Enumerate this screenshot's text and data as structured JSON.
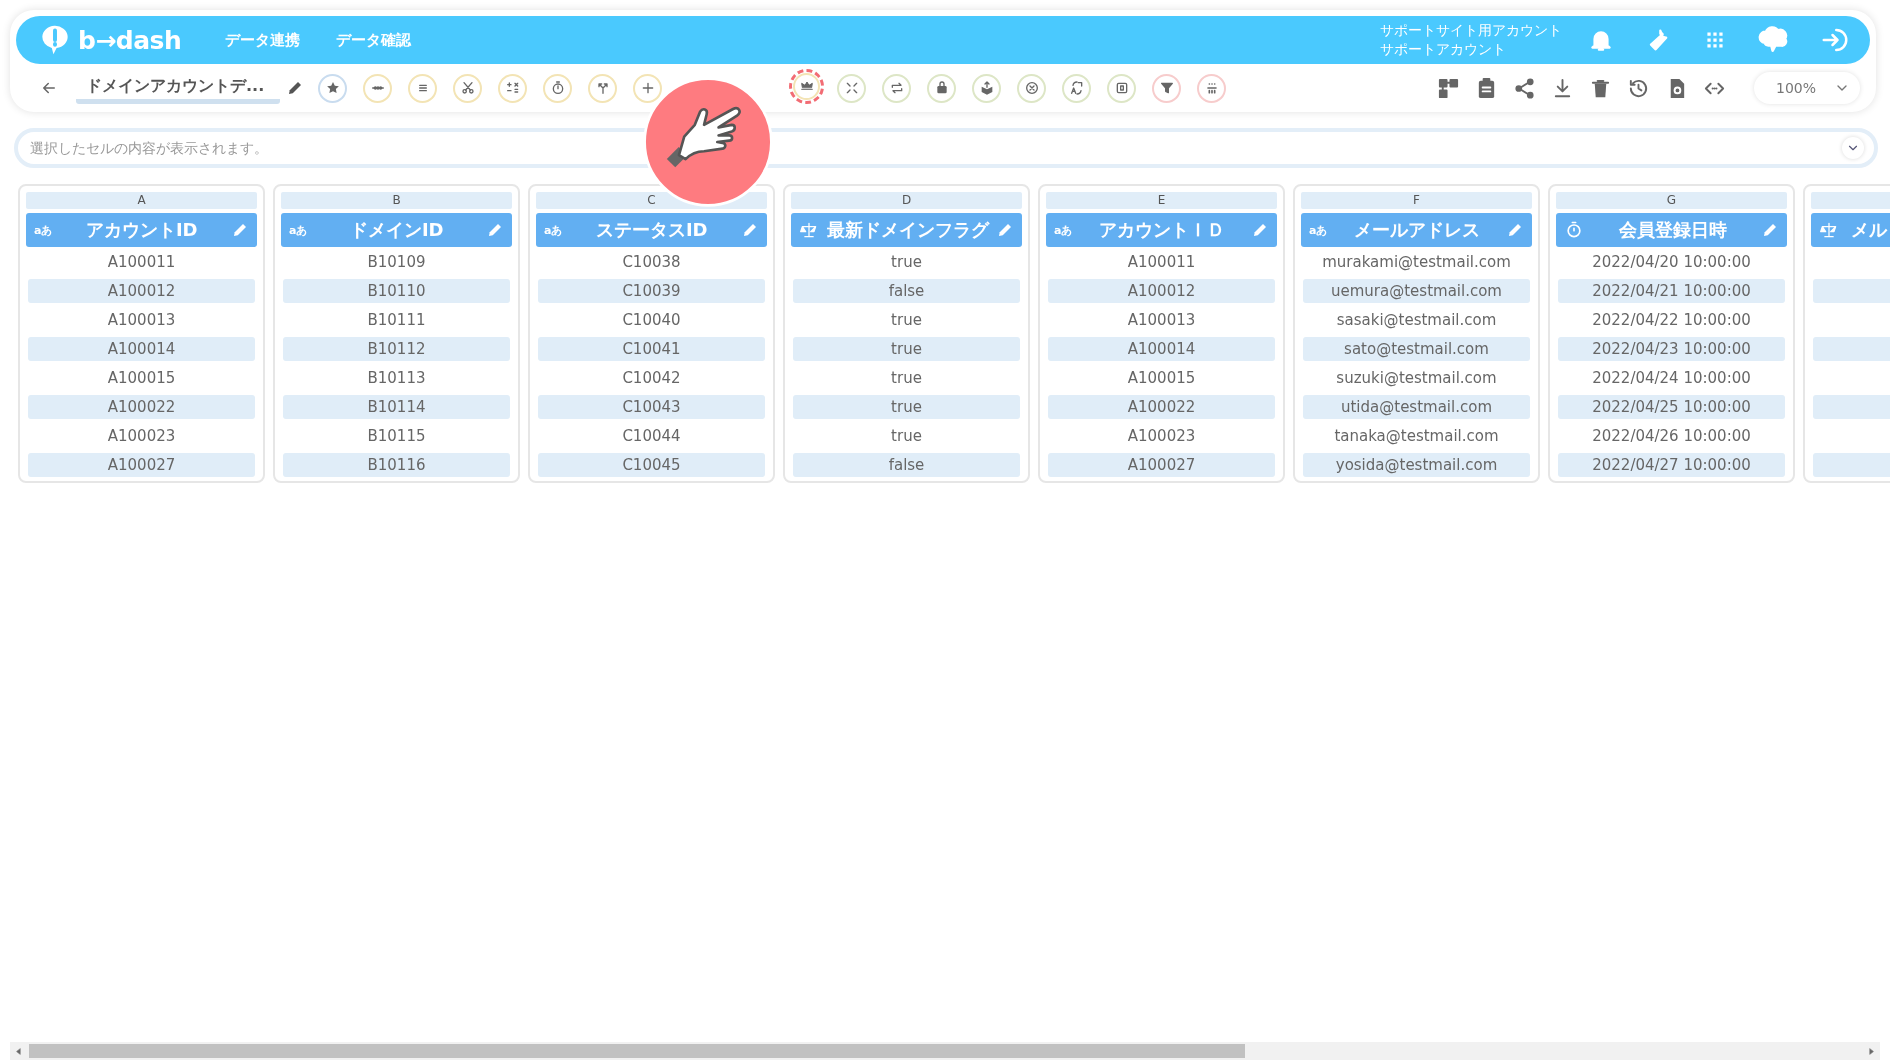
{
  "header": {
    "logo": "b→dash",
    "nav": [
      "データ連携",
      "データ確認"
    ],
    "account": [
      "サポートサイト用アカウント",
      "サポートアカウント"
    ]
  },
  "toolbar": {
    "title": "ドメインアカウントデ...",
    "zoom": "100%"
  },
  "formula_bar": {
    "placeholder": "選択したセルの内容が表示されます。"
  },
  "columns": [
    {
      "letter": "A",
      "name": "アカウントID",
      "kind": "text",
      "type_label": "aあ",
      "cells": [
        "A100011",
        "A100012",
        "A100013",
        "A100014",
        "A100015",
        "A100022",
        "A100023",
        "A100027"
      ]
    },
    {
      "letter": "B",
      "name": "ドメインID",
      "kind": "text",
      "type_label": "aあ",
      "cells": [
        "B10109",
        "B10110",
        "B10111",
        "B10112",
        "B10113",
        "B10114",
        "B10115",
        "B10116"
      ]
    },
    {
      "letter": "C",
      "name": "ステータスID",
      "kind": "text",
      "type_label": "aあ",
      "cells": [
        "C10038",
        "C10039",
        "C10040",
        "C10041",
        "C10042",
        "C10043",
        "C10044",
        "C10045"
      ]
    },
    {
      "letter": "D",
      "name": "最新ドメインフラグ",
      "kind": "boolean",
      "cells": [
        "true",
        "false",
        "true",
        "true",
        "true",
        "true",
        "true",
        "false"
      ]
    },
    {
      "letter": "E",
      "name": "アカウントＩＤ",
      "kind": "text",
      "type_label": "aあ",
      "cells": [
        "A100011",
        "A100012",
        "A100013",
        "A100014",
        "A100015",
        "A100022",
        "A100023",
        "A100027"
      ]
    },
    {
      "letter": "F",
      "name": "メールアドレス",
      "kind": "text",
      "type_label": "aあ",
      "cells": [
        "murakami@testmail.com",
        "uemura@testmail.com",
        "sasaki@testmail.com",
        "sato@testmail.com",
        "suzuki@testmail.com",
        "utida@testmail.com",
        "tanaka@testmail.com",
        "yosida@testmail.com"
      ]
    },
    {
      "letter": "G",
      "name": "会員登録日時",
      "kind": "datetime",
      "cells": [
        "2022/04/20 10:00:00",
        "2022/04/21 10:00:00",
        "2022/04/22 10:00:00",
        "2022/04/23 10:00:00",
        "2022/04/24 10:00:00",
        "2022/04/25 10:00:00",
        "2022/04/26 10:00:00",
        "2022/04/27 10:00:00"
      ]
    },
    {
      "name": "メル",
      "kind": "boolean"
    }
  ]
}
